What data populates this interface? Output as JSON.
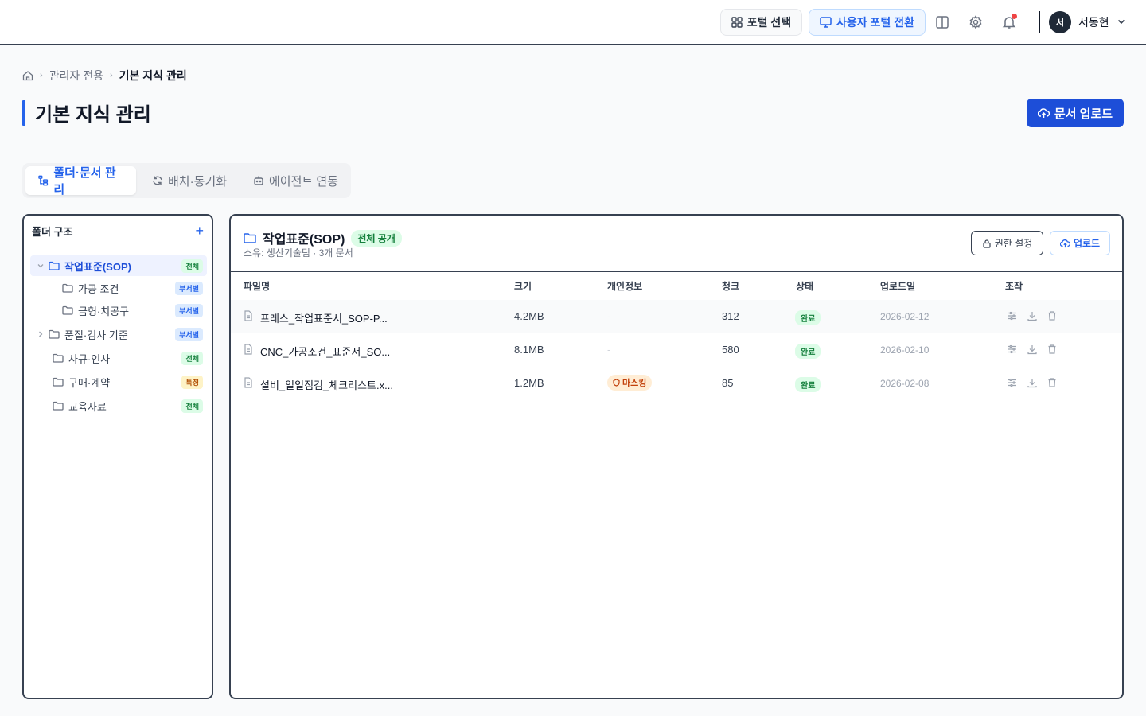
{
  "header": {
    "portal_select": "포털 선택",
    "user_portal_switch": "사용자 포털 전환",
    "avatar_initial": "서",
    "username": "서동현"
  },
  "breadcrumb": {
    "items": [
      "관리자 전용",
      "기본 지식 관리"
    ]
  },
  "page": {
    "title": "기본 지식 관리",
    "upload_button": "문서 업로드"
  },
  "tabs": [
    {
      "label": "폴더·문서 관리",
      "active": true
    },
    {
      "label": "배치·동기화",
      "active": false
    },
    {
      "label": "에이전트 연동",
      "active": false
    }
  ],
  "folder_panel": {
    "title": "폴더 구조",
    "add_symbol": "+",
    "items": [
      {
        "label": "작업표준(SOP)",
        "badge": "전체"
      },
      {
        "label": "가공 조건",
        "badge": "부서별"
      },
      {
        "label": "금형·치공구",
        "badge": "부서별"
      },
      {
        "label": "품질·검사 기준",
        "badge": "부서별"
      },
      {
        "label": "사규·인사",
        "badge": "전체"
      },
      {
        "label": "구매·계약",
        "badge": "특정"
      },
      {
        "label": "교육자료",
        "badge": "전체"
      }
    ]
  },
  "doc_panel": {
    "folder_name": "작업표준(SOP)",
    "visibility_badge": "전체 공개",
    "subtitle": "소유: 생산기술팀 · 3개 문서",
    "permission_button": "권한 설정",
    "upload_button": "업로드",
    "columns": [
      "파일명",
      "크기",
      "개인정보",
      "청크",
      "상태",
      "업로드일",
      "조작"
    ],
    "rows": [
      {
        "name": "프레스_작업표준서_SOP-P...",
        "size": "4.2MB",
        "pii": "-",
        "chunks": "312",
        "status": "완료",
        "date": "2026-02-12"
      },
      {
        "name": "CNC_가공조건_표준서_SO...",
        "size": "8.1MB",
        "pii": "-",
        "chunks": "580",
        "status": "완료",
        "date": "2026-02-10"
      },
      {
        "name": "설비_일일점검_체크리스트.x...",
        "size": "1.2MB",
        "pii": "마스킹",
        "chunks": "85",
        "status": "완료",
        "date": "2026-02-08"
      }
    ]
  }
}
